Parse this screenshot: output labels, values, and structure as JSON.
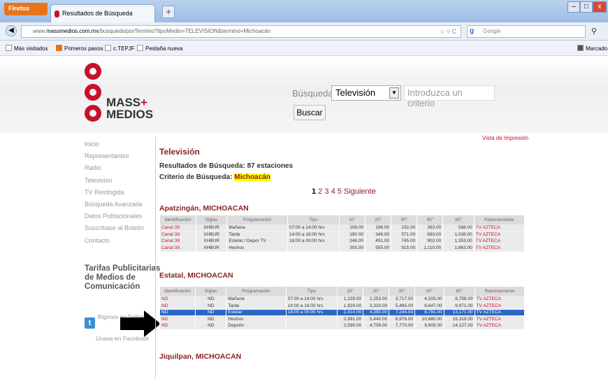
{
  "browser": {
    "firefox_label": "Firefox",
    "tab_title": "Resultados de Búsqueda",
    "new_tab": "+",
    "url_prefix": "www.",
    "url_host": "massmedios.com.mx",
    "url_path": "/busqueda/porTermino?tipoMedio=TELEVISION&termino=Michoacán",
    "search_engine": "Google",
    "search_placeholder": "Google",
    "bookmarks": [
      "Más visitados",
      "Primeros pasos",
      "c.TEPJF",
      "Pestaña nueva"
    ],
    "bookmarks_right": "Marcado",
    "win_min": "–",
    "win_max": "□",
    "win_close": "x"
  },
  "header": {
    "logo_line1": "MASS",
    "logo_plus": "+",
    "logo_line2": "MEDIOS",
    "busqueda_label": "Búsqueda:",
    "select_value": "Televisión",
    "criterio_placeholder": "Introduzca un criterio",
    "buscar_label": "Buscar"
  },
  "sidebar": {
    "items": [
      "Inicio",
      "Representantes",
      "Radio",
      "Televisión",
      "TV Restingida",
      "Búsqueda Avanzada",
      "Datos Poblacionales",
      "Suscríbase al Boletín",
      "Contacto"
    ],
    "tarifas": "Tarifas Publicitarias de Medios de Comunicación",
    "social_label": "Bígonos en Twitter",
    "unase": "Únase en Facebook"
  },
  "main": {
    "vista": "Vista de Impresión",
    "title": "Televisión",
    "resultados": "Resultados de Búsqueda: 87 estaciones",
    "criterio_label": "Criterio de Búsqueda:",
    "criterio_value": "Michoacán",
    "pager": {
      "current": "1",
      "pages": [
        "2",
        "3",
        "4",
        "5"
      ],
      "next": "Siguiente"
    },
    "columns": [
      "Identificación",
      "Siglas",
      "Programación",
      "Tipo",
      "10\"",
      "20\"",
      "30\"",
      "40\"",
      "60\"",
      "Representante"
    ],
    "sections": [
      {
        "name": "Apatzingán, MICHOACAN",
        "rows": [
          [
            "Canal 39",
            "XHBUR",
            "Mañana",
            "07:00 a 14:00 hrs",
            "108.00",
            "196.00",
            "232.00",
            "393.00",
            "588.00",
            "TV AZTECA"
          ],
          [
            "Canal 39",
            "XHBUR",
            "Tarde",
            "14:00 a 18:00 hrs",
            "190.00",
            "346.00",
            "571.00",
            "693.00",
            "1,039.00",
            "TV AZTECA"
          ],
          [
            "Canal 39",
            "XHBUR",
            "Estelar / Depor TV",
            "18:00 a 00:00 hrs",
            "248.00",
            "451.00",
            "745.00",
            "902.00",
            "1,353.00",
            "TV AZTECA"
          ],
          [
            "Canal 39",
            "XHBUR",
            "Hechos",
            "",
            "305.00",
            "555.00",
            "915.00",
            "1,110.00",
            "1,663.00",
            "TV AZTECA"
          ]
        ]
      },
      {
        "name": "Estatal, MICHOACAN",
        "rows": [
          [
            "ND",
            "ND",
            "Mañana",
            "07:00 a 14:00 hrs",
            "1,229.00",
            "2,253.00",
            "3,717.00",
            "4,505.00",
            "6,758.00",
            "TV AZTECA"
          ],
          [
            "ND",
            "ND",
            "Tarde",
            "14:00 a 18:00 hrs",
            "1,829.00",
            "3,324.00",
            "5,485.00",
            "6,647.00",
            "9,971.00",
            "TV AZTECA"
          ],
          [
            "ND",
            "ND",
            "Estelar",
            "18:00 a 00:00 hrs",
            "2,414.00",
            "4,390.00",
            "7,244.00",
            "8,781.00",
            "13,171.00",
            "TV AZTECA"
          ],
          [
            "ND",
            "ND",
            "Hechos",
            "",
            "2,991.00",
            "5,440.00",
            "8,976.00",
            "10,880.00",
            "16,319.00",
            "TV AZTECA"
          ],
          [
            "ND",
            "ND",
            "Deportv",
            "",
            "2,590.00",
            "4,708.00",
            "7,770.00",
            "9,605.00",
            "14,127.00",
            "TV AZTECA"
          ]
        ]
      },
      {
        "name": "Jiquilpan, MICHOACAN",
        "rows": []
      }
    ]
  }
}
